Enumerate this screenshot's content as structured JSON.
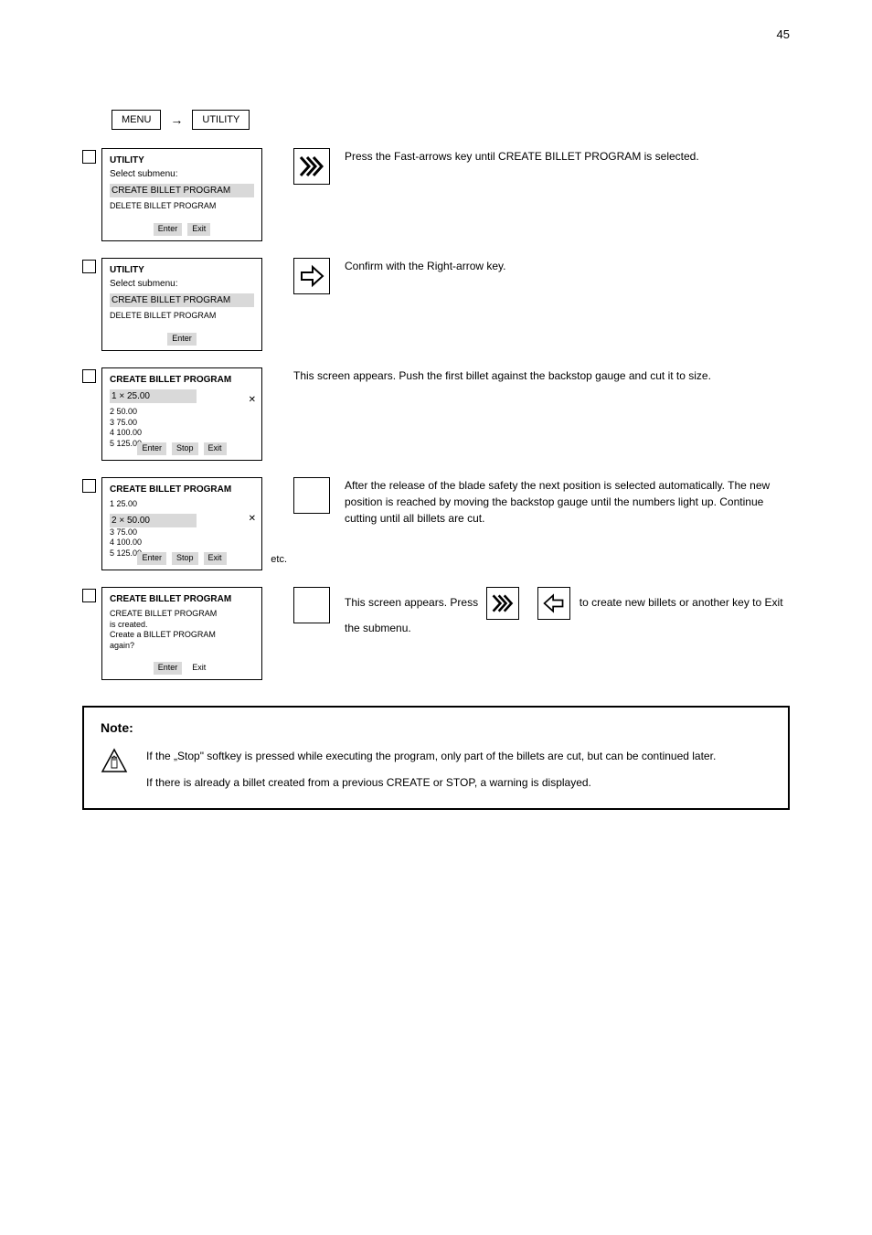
{
  "page_number": "45",
  "breadcrumb": {
    "a": "MENU",
    "b": "UTILITY"
  },
  "steps": [
    {
      "screen": {
        "title": "UTILITY",
        "sub": "Select submenu:",
        "hi_line": "CREATE BILLET PROGRAM",
        "small_lines": [
          "DELETE BILLET PROGRAM"
        ],
        "softkeys": [
          {
            "label": "Enter",
            "hi": true
          },
          {
            "label": "Exit",
            "hi": true
          }
        ]
      },
      "rhs": {
        "button": "fast",
        "text": "Press the Fast-arrows key until CREATE BILLET PROGRAM is selected."
      }
    },
    {
      "screen": {
        "title": "UTILITY",
        "sub": "Select submenu:",
        "hi_line": "CREATE BILLET PROGRAM",
        "small_lines": [
          "DELETE BILLET PROGRAM"
        ],
        "softkeys": [
          {
            "label": "Enter",
            "hi": true
          }
        ]
      },
      "rhs": {
        "button": "right",
        "text": "Confirm with the Right-arrow key."
      }
    },
    {
      "screen": {
        "title": "CREATE BILLET PROGRAM",
        "hi_line": "1 × 25.00",
        "small_lines": [
          "2     50.00",
          "3     75.00",
          "4  100.00",
          "5  125.00"
        ],
        "softkeys": [
          {
            "label": "Enter",
            "hi": true
          },
          {
            "label": "Stop",
            "hi": true
          },
          {
            "label": "Exit",
            "hi": true
          }
        ],
        "x_mark": true
      },
      "rhs": {
        "button": "none",
        "text": "This screen appears. Push the first billet against the backstop gauge and cut it to size."
      }
    },
    {
      "screen": {
        "title": "CREATE BILLET PROGRAM",
        "sub": "1     25.00",
        "hi_line": "2 × 50.00",
        "small_lines": [
          "3     75.00",
          "4  100.00",
          "5  125.00"
        ],
        "softkeys": [
          {
            "label": "Enter",
            "hi": true
          },
          {
            "label": "Stop",
            "hi": true
          },
          {
            "label": "Exit",
            "hi": true
          }
        ],
        "tag": "etc.",
        "x_mark": true
      },
      "rhs": {
        "button": "blank",
        "text": "After the release of the blade safety the next position is selected automatically. The new position is reached by moving the backstop gauge until the numbers light up. Continue cutting until all billets are cut."
      }
    },
    {
      "screen": {
        "title": "CREATE BILLET PROGRAM",
        "sub_lines": [
          "CREATE BILLET PROGRAM",
          "is created.",
          "Create a BILLET PROGRAM",
          "again?"
        ],
        "softkeys": [
          {
            "label": "Enter",
            "hi": true
          },
          {
            "label": "Exit",
            "hi": false
          }
        ]
      },
      "rhs": {
        "button": "blank",
        "text_pre": "This screen appears. Press ",
        "icons": [
          "fast",
          "left"
        ],
        "text_post": " to create new billets or another key to Exit the submenu."
      }
    }
  ],
  "note": {
    "title": "Note:",
    "line1": "If the „Stop\" softkey is pressed while executing the program, only part of the billets are cut, but can be continued later.",
    "line2": "If there is already a billet created from a previous CREATE or STOP, a warning is displayed."
  }
}
